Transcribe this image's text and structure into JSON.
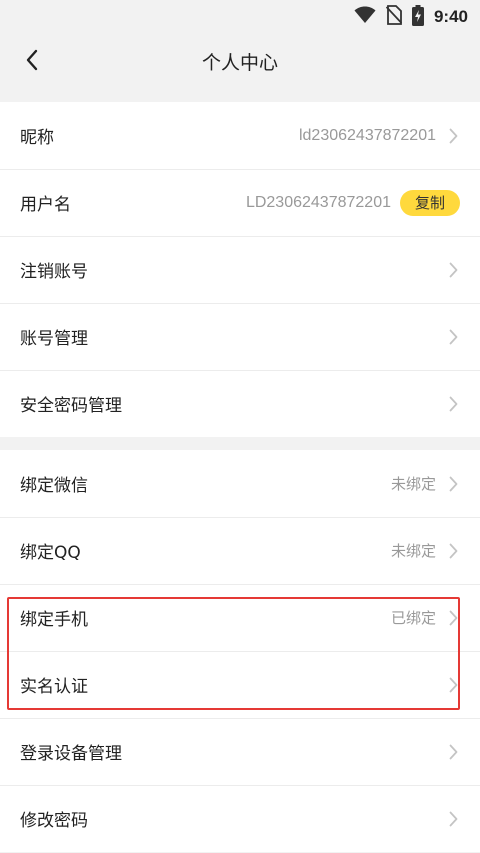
{
  "status_bar": {
    "time": "9:40",
    "icons": [
      "wifi-icon",
      "no-sim-icon",
      "battery-charging-icon"
    ]
  },
  "nav": {
    "back_icon": "chevron-left-icon",
    "title": "个人中心"
  },
  "profile": {
    "nickname_label": "昵称",
    "nickname_value": "ld23062437872201",
    "username_label": "用户名",
    "username_value": "LD23062437872201",
    "copy_label": "复制",
    "cancel_account_label": "注销账号",
    "account_manage_label": "账号管理",
    "security_password_label": "安全密码管理"
  },
  "bindings": {
    "wechat_label": "绑定微信",
    "wechat_status": "未绑定",
    "qq_label": "绑定QQ",
    "qq_status": "未绑定",
    "phone_label": "绑定手机",
    "phone_status": "已绑定",
    "realname_label": "实名认证",
    "device_manage_label": "登录设备管理",
    "change_password_label": "修改密码"
  },
  "colors": {
    "background": "#f2f2f2",
    "copy_button": "#ffd93d",
    "highlight": "#e53935",
    "secondary_text": "#999999"
  }
}
